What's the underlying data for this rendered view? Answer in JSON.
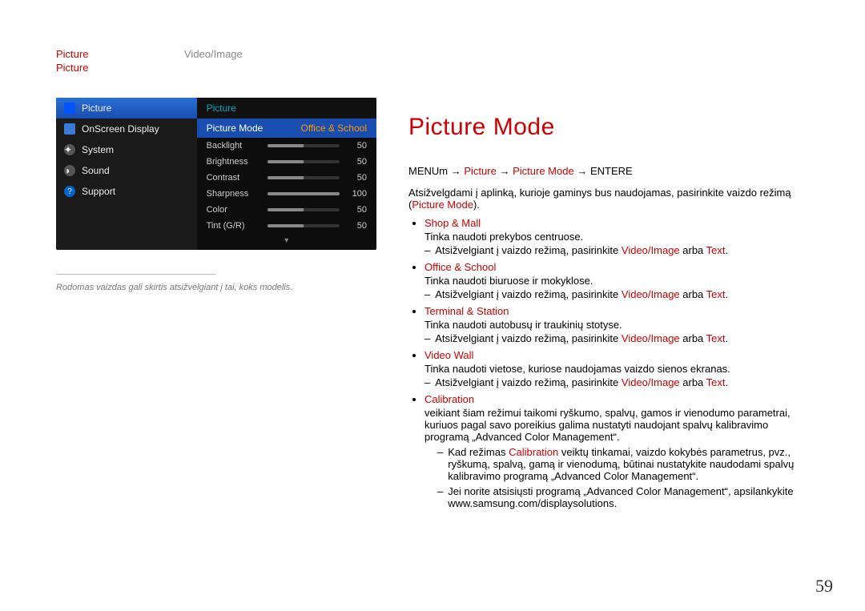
{
  "breadcrumb": {
    "a": "Picture",
    "b": "Video/Image",
    "c": "Picture"
  },
  "osd": {
    "left": [
      {
        "label": "Picture",
        "active": true,
        "icon": "picture-icon"
      },
      {
        "label": "OnScreen Display",
        "active": false,
        "icon": "osd-icon"
      },
      {
        "label": "System",
        "active": false,
        "icon": "system-icon"
      },
      {
        "label": "Sound",
        "active": false,
        "icon": "sound-icon"
      },
      {
        "label": "Support",
        "active": false,
        "icon": "support-icon"
      }
    ],
    "panel_title": "Picture",
    "mode_label": "Picture Mode",
    "mode_value": "Office & School",
    "sliders": [
      {
        "label": "Backlight",
        "value": 50,
        "max": 100
      },
      {
        "label": "Brightness",
        "value": 50,
        "max": 100
      },
      {
        "label": "Contrast",
        "value": 50,
        "max": 100
      },
      {
        "label": "Sharpness",
        "value": 100,
        "max": 100
      },
      {
        "label": "Color",
        "value": 50,
        "max": 100
      },
      {
        "label": "Tint (G/R)",
        "value": 50,
        "max": 100
      }
    ]
  },
  "caption": "Rodomas vaizdas gali skirtis atsižvelgiant į tai, koks modelis.",
  "heading": "Picture Mode",
  "menuline": {
    "prefix": "MENU",
    "m": "m",
    "arrow": "→",
    "seg1": "Picture",
    "seg2": "Picture Mode",
    "seg3": "ENTER",
    "e": "E"
  },
  "intro": {
    "pre": "Atsižvelgdami į aplinką, kurioje gaminys bus naudojamas, pasirinkite vaizdo režimą (",
    "red": "Picture Mode",
    "post": ")."
  },
  "modes": [
    {
      "name": "Shop & Mall",
      "desc": "Tinka naudoti prekybos centruose.",
      "sub_pre": "Atsižvelgiant į vaizdo režimą, pasirinkite ",
      "sub_red1": "Video/Image",
      "sub_mid": " arba ",
      "sub_red2": "Text",
      "sub_post": "."
    },
    {
      "name": "Office & School",
      "desc": "Tinka naudoti biuruose ir mokyklose.",
      "sub_pre": "Atsižvelgiant į vaizdo režimą, pasirinkite ",
      "sub_red1": "Video/Image",
      "sub_mid": " arba ",
      "sub_red2": "Text",
      "sub_post": "."
    },
    {
      "name": "Terminal & Station",
      "desc": "Tinka naudoti autobusų ir traukinių stotyse.",
      "sub_pre": "Atsižvelgiant į vaizdo režimą, pasirinkite ",
      "sub_red1": "Video/Image",
      "sub_mid": " arba ",
      "sub_red2": "Text",
      "sub_post": "."
    },
    {
      "name": "Video Wall",
      "desc": "Tinka naudoti vietose, kuriose naudojamas vaizdo sienos ekranas.",
      "sub_pre": "Atsižvelgiant į vaizdo režimą, pasirinkite ",
      "sub_red1": "Video/Image",
      "sub_mid": " arba ",
      "sub_red2": "Text",
      "sub_post": "."
    }
  ],
  "calibration": {
    "name": "Calibration",
    "p1": "veikiant šiam režimui taikomi ryškumo, spalvų, gamos ir vienodumo parametrai, kuriuos pagal savo poreikius galima nustatyti naudojant spalvų kalibravimo programą „Advanced Color Management“.",
    "p2_pre": "Kad režimas ",
    "p2_red": "Calibration",
    "p2_post": " veiktų tinkamai, vaizdo kokybės parametrus, pvz., ryškumą, spalvą, gamą ir vienodumą, būtinai nustatykite naudodami spalvų kalibravimo programą „Advanced Color Management“.",
    "p3": "Jei norite atsisiųsti programą „Advanced Color Management“, apsilankykite www.samsung.com/displaysolutions."
  },
  "page_number": "59"
}
